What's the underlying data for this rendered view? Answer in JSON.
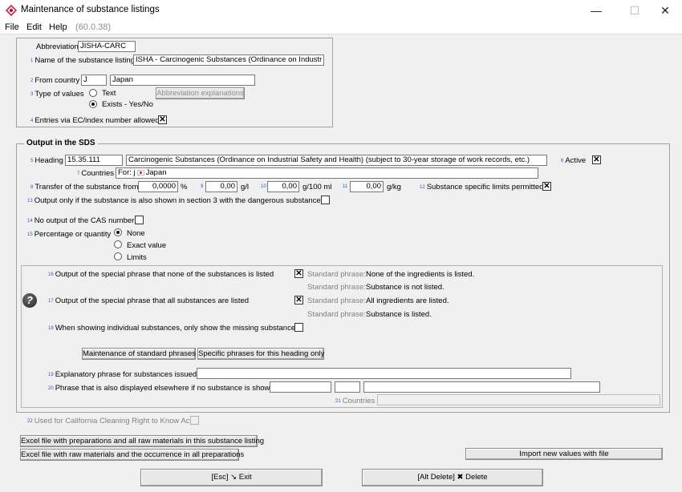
{
  "window": {
    "title": "Maintenance of substance listings",
    "minimize_glyph": "—",
    "maximize_glyph": "☐",
    "close_glyph": "✕"
  },
  "menu": {
    "file": "File",
    "edit": "Edit",
    "help": "Help",
    "version": "(60.0.38)"
  },
  "header": {
    "abbreviation_label": "Abbreviation",
    "abbreviation_value": "JISHA-CARC",
    "name_num": "1",
    "name_label": "Name of the substance listing",
    "name_value": "ISHA - Carcinogenic Substances (Ordinance on Industr",
    "country_num": "2",
    "country_label": "From country",
    "country_code": "J",
    "country_name": "Japan",
    "type_num": "3",
    "type_label": "Type of values",
    "type_text": "Text",
    "type_exists": "Exists - Yes/No",
    "abbrev_expl_button": "Abbreviation explanations",
    "entries_num": "4",
    "entries_label": "Entries via EC/index number allowed",
    "entries_check": "✕"
  },
  "sds": {
    "legend": "Output in the SDS",
    "heading_num": "5",
    "heading_label": "Heading",
    "heading_code": "15.35.111",
    "heading_text": "Carcinogenic Substances (Ordinance on Industrial Safety and Health) (subject to 30-year storage of work records, etc.)",
    "active_num": "6",
    "active_label": "Active",
    "active_check": "✕",
    "countries_num": "7",
    "countries_label": "Countries",
    "countries_prefix": "For: j",
    "countries_value": "Japan",
    "transfer_num": "8",
    "transfer_label": "Transfer of the substance from",
    "transfer_pct": "0,0000",
    "pct_unit": "%",
    "gl_num": "9",
    "gl_value": "0,00",
    "gl_unit": "g/l",
    "g100_num": "10",
    "g100_value": "0,00",
    "g100_unit": "g/100 ml",
    "gkg_num": "11",
    "gkg_value": "0,00",
    "gkg_unit": "g/kg",
    "limits_num": "12",
    "limits_label": "Substance specific limits permitted",
    "limits_check": "✕",
    "only_sec3_num": "13",
    "only_sec3_label": "Output only if the substance is also shown in section 3 with the dangerous substances",
    "no_cas_num": "14",
    "no_cas_label": "No output of the CAS number",
    "pct_qty_num": "15",
    "pct_qty_label": "Percentage or quantity",
    "opt_none": "None",
    "opt_exact": "Exact value",
    "opt_limits": "Limits"
  },
  "phrases": {
    "none_listed_num": "16",
    "none_listed_label": "Output of the special phrase that none of the substances is listed",
    "none_listed_check": "✕",
    "std_label": "Standard phrase:",
    "std_none_listed": "None of the ingredients is listed.",
    "std_not_listed": "Substance is not listed.",
    "all_listed_num": "17",
    "all_listed_label": "Output of the special phrase that all substances are listed",
    "all_listed_check": "✕",
    "std_all_listed": "All ingredients are listed.",
    "std_is_listed": "Substance is listed.",
    "missing_num": "18",
    "missing_label": "When showing individual substances, only show the missing substances",
    "maint_std_button": "Maintenance of standard phrases",
    "specific_button": "Specific phrases for this heading only",
    "explanatory_num": "19",
    "explanatory_label": "Explanatory phrase for substances issued",
    "elsewhere_num": "20",
    "elsewhere_label": "Phrase that is also displayed elsewhere if no substance is shown",
    "countries_num": "21",
    "countries_label": "Countries",
    "help_glyph": "?"
  },
  "footer": {
    "california_num": "22",
    "california_label": "Used for California Cleaning Right to Know Act",
    "excel_all_button": "Excel file with preparations and all raw materials in this substance listing",
    "excel_raw_button": "Excel file with raw materials and the occurrence in all preparations",
    "import_button": "Import new values with file",
    "exit_button": "[Esc] ↘ Exit",
    "delete_button": "[Alt Delete] ✖ Delete"
  },
  "colors": {
    "window_bg": "#f0f0f0",
    "number_blue": "#2a5cc0",
    "app_icon_red": "#c8102e"
  }
}
